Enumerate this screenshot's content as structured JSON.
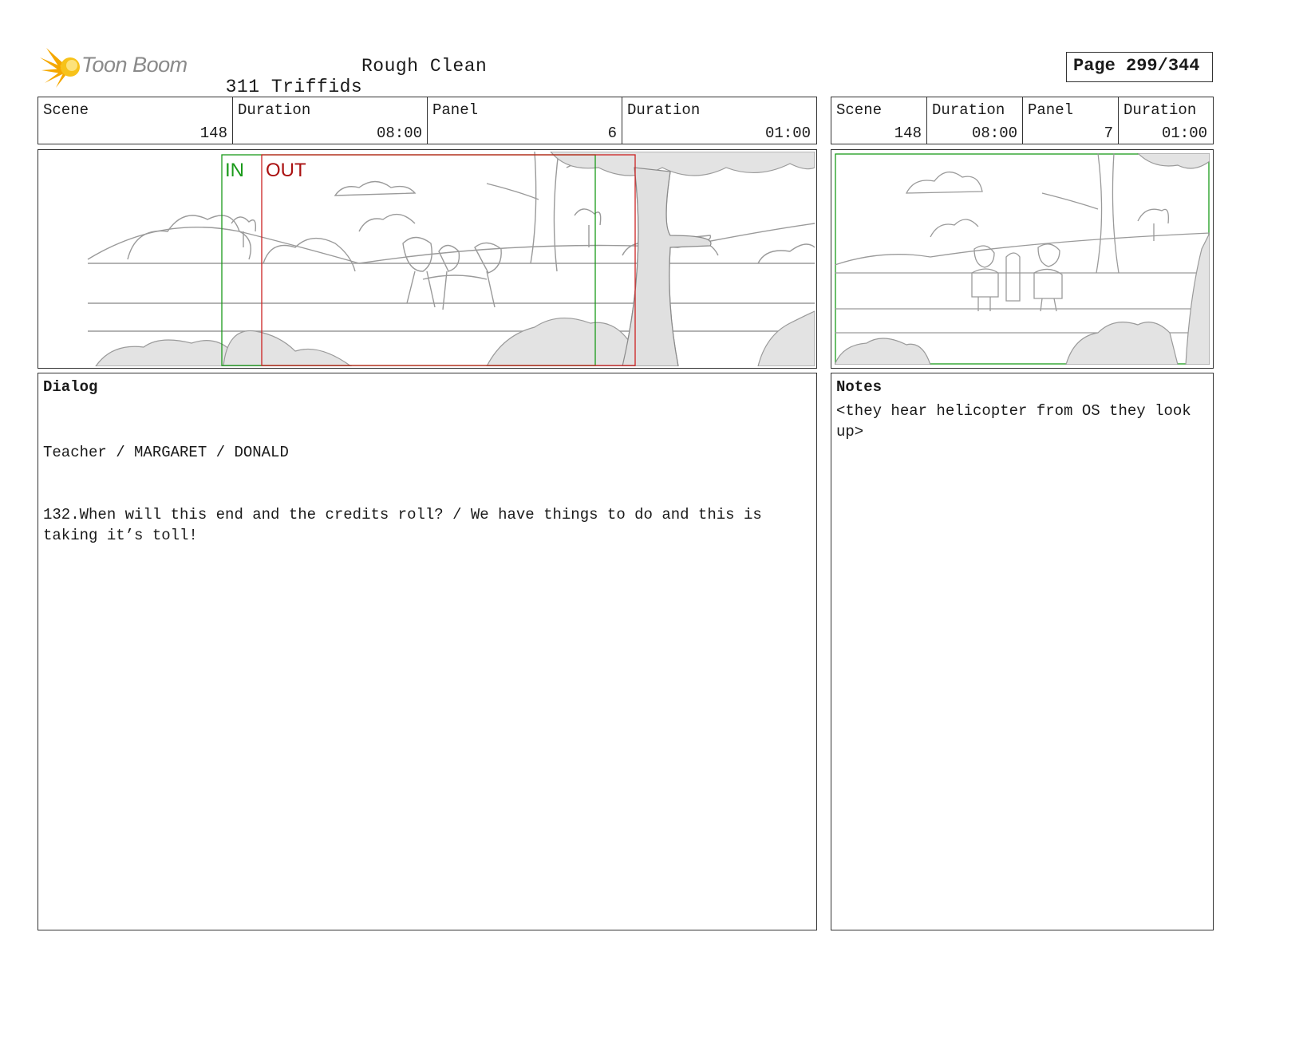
{
  "header": {
    "logo_text": "Toon Boom",
    "project_title": "311 Triffids",
    "version_label": "Rough Clean",
    "page_label": "Page 299/344"
  },
  "panel_left": {
    "scene_label": "Scene",
    "scene_value": "148",
    "duration_label": "Duration",
    "duration_value": "08:00",
    "panel_label": "Panel",
    "panel_value": "6",
    "panel_duration_label": "Duration",
    "panel_duration_value": "01:00",
    "in_marker": "IN",
    "out_marker": "OUT"
  },
  "panel_right": {
    "scene_label": "Scene",
    "scene_value": "148",
    "duration_label": "Duration",
    "duration_value": "08:00",
    "panel_label": "Panel",
    "panel_value": "7",
    "panel_duration_label": "Duration",
    "panel_duration_value": "01:00"
  },
  "dialog": {
    "title": "Dialog",
    "characters": "Teacher / MARGARET / DONALD",
    "text": "132.When will this end and the credits roll? / We have things to do and this is\ntaking it’s toll!"
  },
  "notes": {
    "title": "Notes",
    "text": "<they hear helicopter from OS they look\nup>"
  },
  "colors": {
    "in_marker": "#1a9a1a",
    "out_marker": "#aa1111",
    "logo_orange": "#f5a800",
    "border": "#333333"
  }
}
